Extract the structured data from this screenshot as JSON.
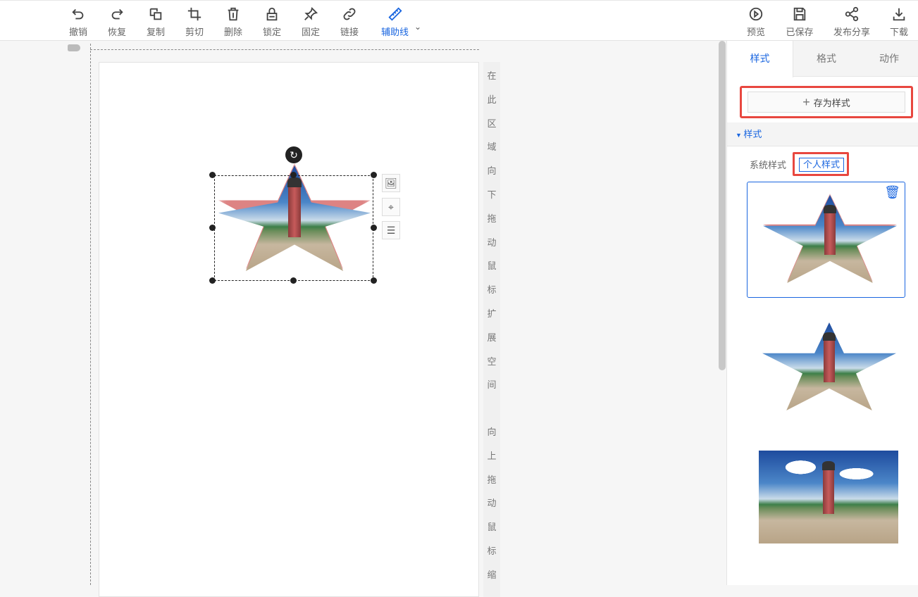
{
  "toolbar": {
    "left": [
      {
        "label": "撤销",
        "icon": "undo-icon"
      },
      {
        "label": "恢复",
        "icon": "redo-icon"
      },
      {
        "label": "复制",
        "icon": "copy-icon"
      },
      {
        "label": "剪切",
        "icon": "crop-icon"
      },
      {
        "label": "删除",
        "icon": "trash-icon"
      },
      {
        "label": "锁定",
        "icon": "lock-icon"
      },
      {
        "label": "固定",
        "icon": "pin-icon"
      },
      {
        "label": "链接",
        "icon": "link-icon"
      },
      {
        "label": "辅助线",
        "icon": "ruler-icon"
      }
    ],
    "right": [
      {
        "label": "预览",
        "icon": "play-icon"
      },
      {
        "label": "已保存",
        "icon": "save-icon"
      },
      {
        "label": "发布分享",
        "icon": "share-icon"
      },
      {
        "label": "下载",
        "icon": "download-icon"
      }
    ]
  },
  "strip": {
    "top": "在此区域向下拖动鼠标扩展空间",
    "bottom": "向上拖动鼠标缩"
  },
  "panel": {
    "tabs": [
      "样式",
      "格式",
      "动作"
    ],
    "save_style": "存为样式",
    "section": "样式",
    "subtabs": {
      "system": "系统样式",
      "personal": "个人样式"
    }
  },
  "colors": {
    "accent": "#1a66e0",
    "highlight": "#e8473f"
  }
}
